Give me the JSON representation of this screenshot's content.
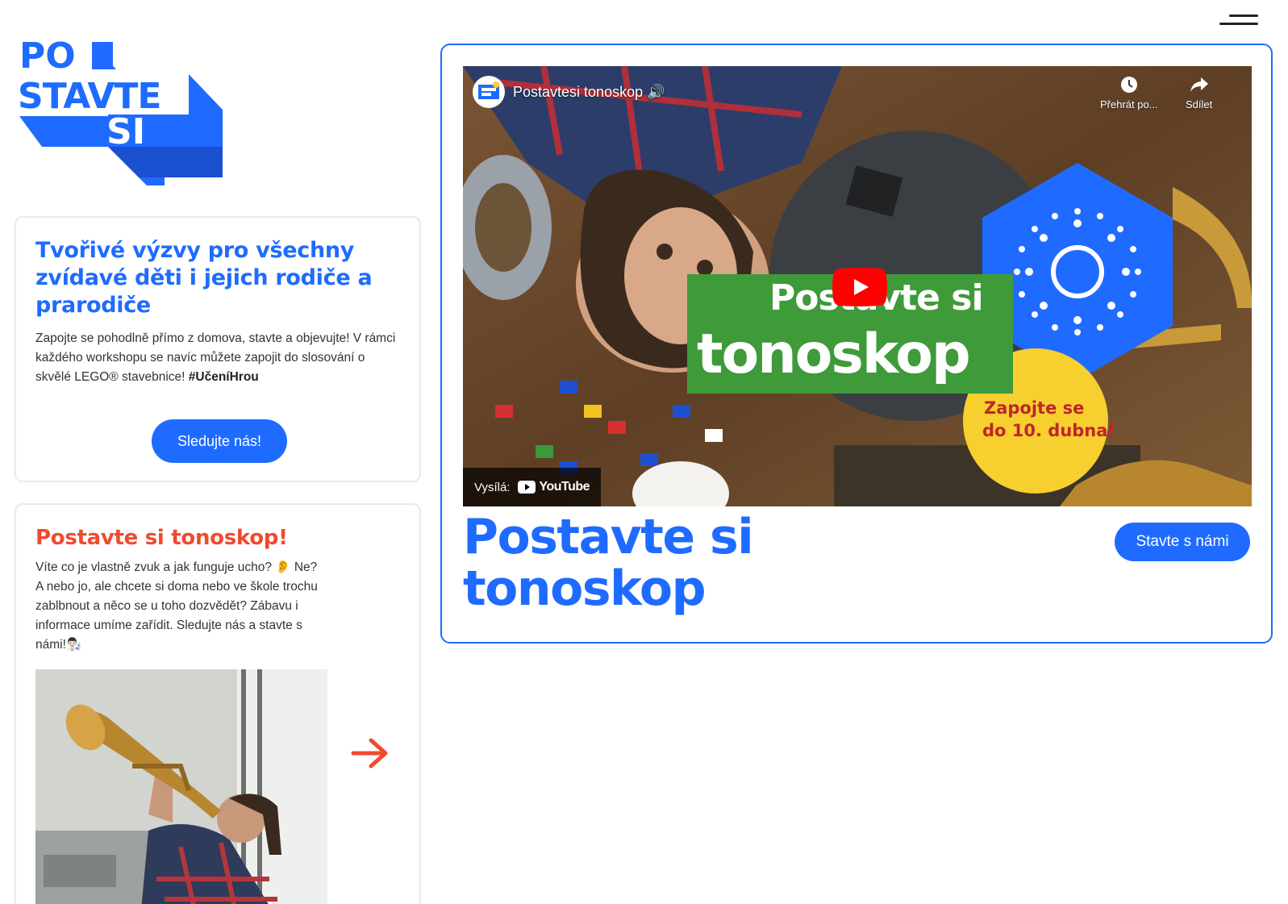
{
  "brand": {
    "logo_text": "PO STAVTE SI",
    "primary_color": "#1f6bff",
    "accent_color": "#f04a2e"
  },
  "header": {
    "menu_icon": "hamburger-icon"
  },
  "intro": {
    "title": "Tvořivé výzvy pro všechny zvídavé děti i jejich rodiče a prarodiče",
    "text": "Zapojte se pohodlně přímo z domova, stavte a objevujte! V rámci každého workshopu se navíc můžete zapojit do slosování o skvělé LEGO® stavebnice!",
    "hashtag": "#UčeníHrou",
    "button_label": "Sledujte nás!"
  },
  "post": {
    "title": "Postavte si tonoskop!",
    "text_1": "Víte co je vlastně zvuk a jak funguje ucho? 👂 Ne? A nebo jo, ale chcete si doma nebo ve škole trochu zablbnout a něco se u toho dozvědět? Zábavu i informace umíme zařídit. Sledujte nás a stavte s námi!👨🏻‍🔬",
    "next_icon": "arrow-right-icon"
  },
  "feature": {
    "video": {
      "title": "Postavtesi tonoskop 🔊",
      "watch_later_label": "Přehrát po...",
      "share_label": "Sdílet",
      "sent_by_label": "Vysílá:",
      "platform_label": "YouTube",
      "thumb_title_1": "Postavte si",
      "thumb_title_2": "tonoskop",
      "thumb_badge_1": "Zapojte se",
      "thumb_badge_2": "do 10. dubna!"
    },
    "title": "Postavte si tonoskop",
    "button_label": "Stavte s námi"
  }
}
